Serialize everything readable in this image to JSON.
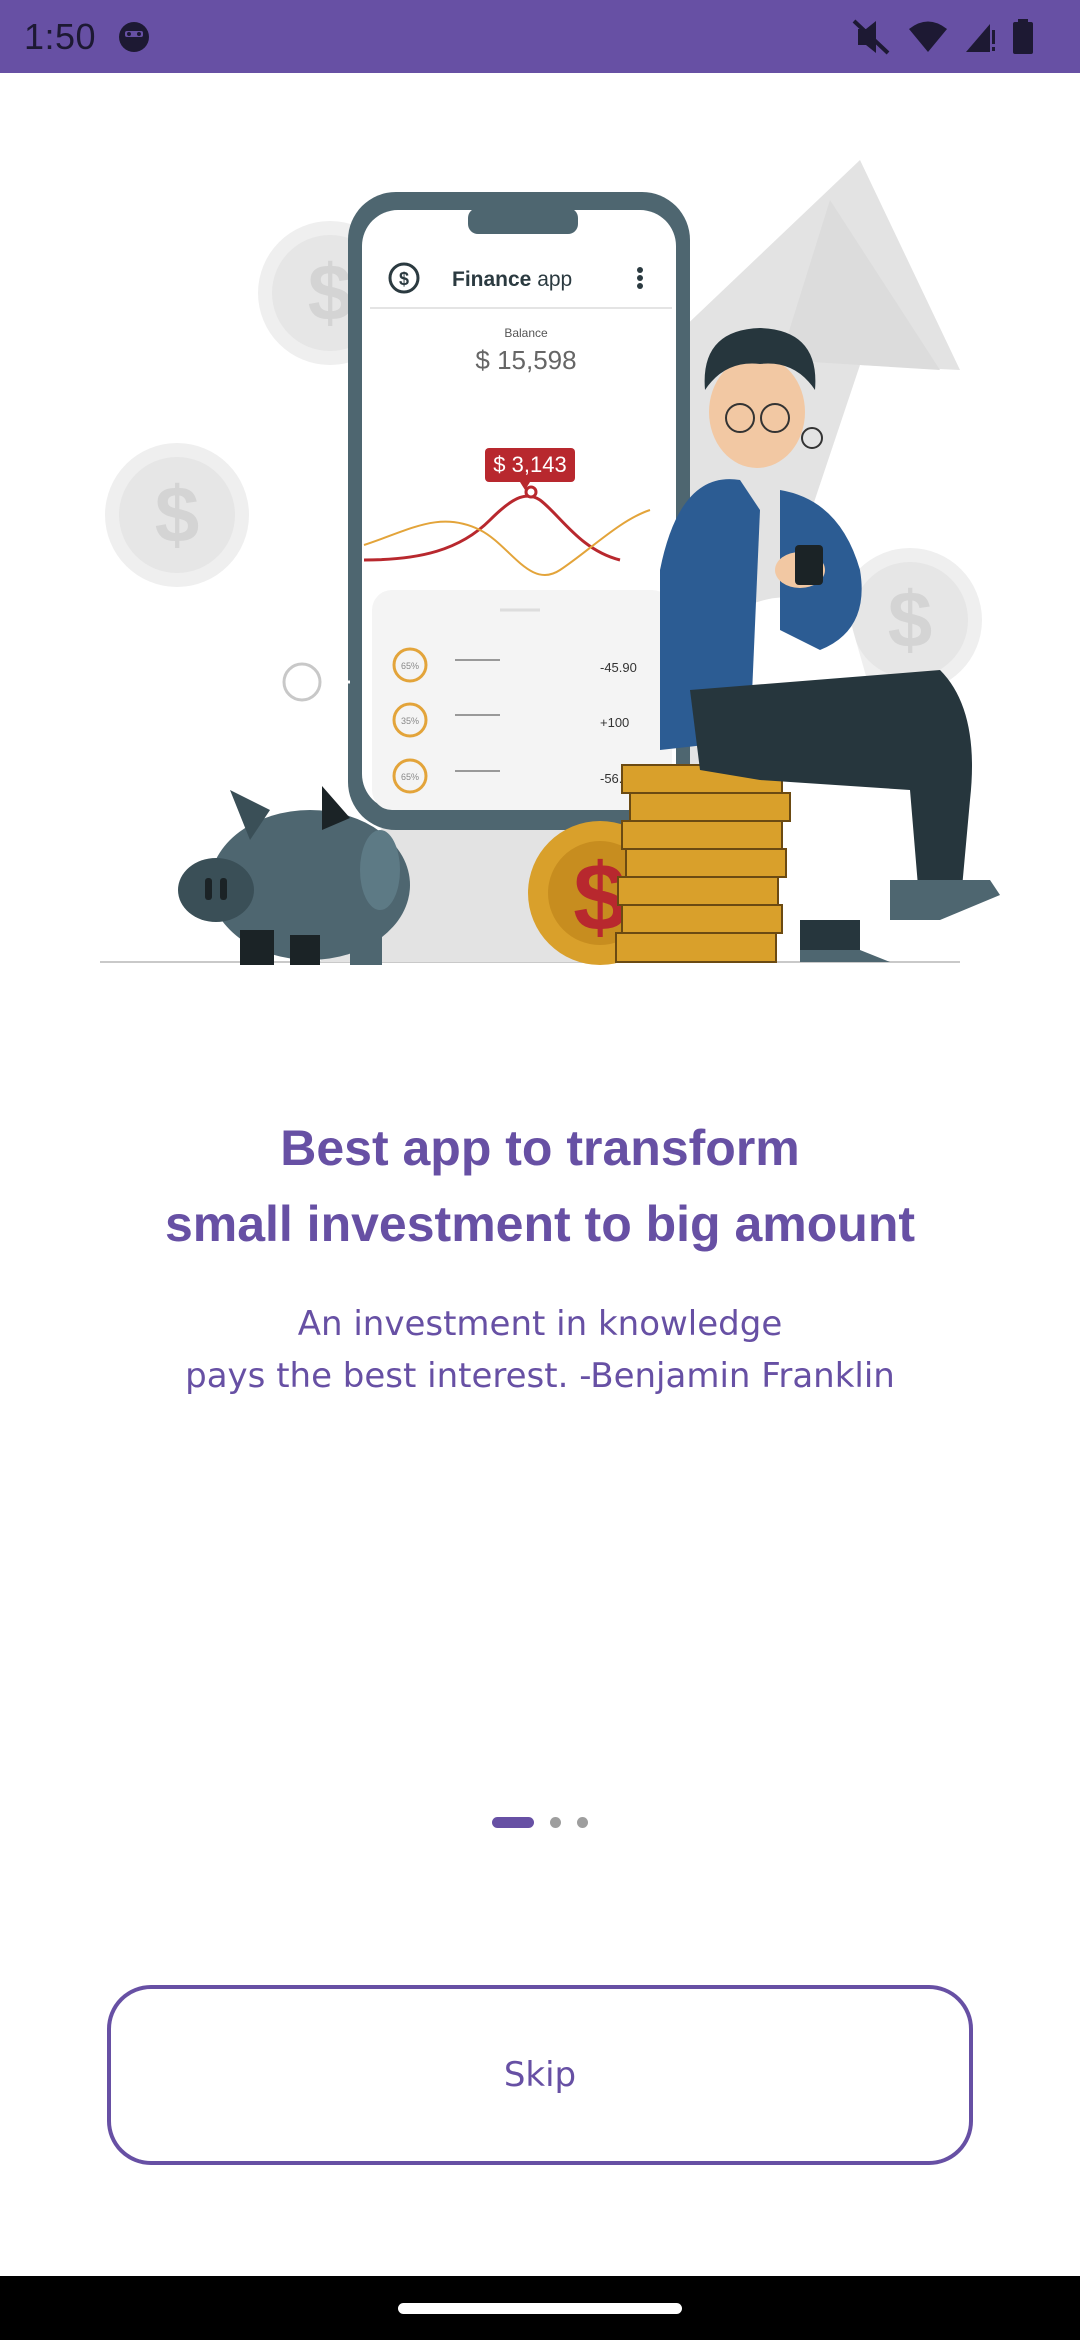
{
  "status_bar": {
    "time": "1:50",
    "app_icon": "android-debug-icon",
    "icons": [
      "vibrate-off-icon",
      "wifi-icon",
      "signal-icon",
      "battery-icon"
    ],
    "background_color": "#6750a4"
  },
  "illustration": {
    "app_title_bold": "Finance",
    "app_title_regular": " app",
    "balance_label": "Balance",
    "balance_value": "$ 15,598",
    "tooltip_value": "$ 3,143",
    "transactions": [
      {
        "percent": "65%",
        "amount": "-45.90"
      },
      {
        "percent": "35%",
        "amount": "+100"
      },
      {
        "percent": "65%",
        "amount": "-56.90"
      }
    ],
    "coin_symbol": "$"
  },
  "onboarding": {
    "headline_line1": "Best app to transform",
    "headline_line2": "small investment to big amount",
    "quote_line1": "An investment in knowledge",
    "quote_line2": "pays the best interest. -Benjamin Franklin",
    "accent_color": "#6750a4"
  },
  "pager": {
    "total_pages": 3,
    "current_page": 1
  },
  "actions": {
    "skip_label": "Skip"
  }
}
